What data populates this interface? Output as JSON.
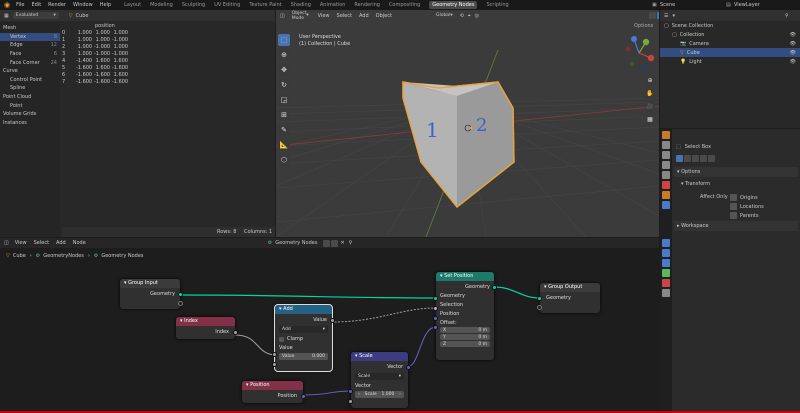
{
  "topbar": {
    "menus": [
      "File",
      "Edit",
      "Render",
      "Window",
      "Help"
    ],
    "workspaces": [
      "Layout",
      "Modeling",
      "Sculpting",
      "UV Editing",
      "Texture Paint",
      "Shading",
      "Animation",
      "Rendering",
      "Compositing",
      "Geometry Nodes",
      "Scripting"
    ],
    "active_workspace": "Geometry Nodes",
    "scene": "Scene",
    "view_layer": "ViewLayer"
  },
  "spreadsheet": {
    "mode": "Evaluated",
    "object": "Cube",
    "tree": [
      {
        "label": "Mesh",
        "indent": 0
      },
      {
        "label": "Vertex",
        "indent": 1,
        "count": "8",
        "selected": true
      },
      {
        "label": "Edge",
        "indent": 1,
        "count": "12"
      },
      {
        "label": "Face",
        "indent": 1,
        "count": "6"
      },
      {
        "label": "Face Corner",
        "indent": 1,
        "count": "24"
      },
      {
        "label": "Curve",
        "indent": 0
      },
      {
        "label": "Control Point",
        "indent": 1
      },
      {
        "label": "Spline",
        "indent": 1
      },
      {
        "label": "Point Cloud",
        "indent": 0
      },
      {
        "label": "Point",
        "indent": 1
      },
      {
        "label": "Volume Grids",
        "indent": 0
      },
      {
        "label": "Instances",
        "indent": 0
      }
    ],
    "column_header": "position",
    "rows": [
      [
        "0",
        "1.000",
        "1.000",
        "1.000"
      ],
      [
        "1",
        "1.000",
        "1.000",
        "-1.000"
      ],
      [
        "2",
        "1.000",
        "-1.000",
        "1.000"
      ],
      [
        "3",
        "1.000",
        "-1.000",
        "-1.000"
      ],
      [
        "4",
        "-1.400",
        "1.600",
        "1.600"
      ],
      [
        "5",
        "-1.600",
        "1.600",
        "-1.600"
      ],
      [
        "6",
        "-1.600",
        "-1.600",
        "1.600"
      ],
      [
        "7",
        "-1.600",
        "-1.600",
        "-1.600"
      ]
    ],
    "footer_rows": "Rows: 8",
    "footer_cols": "Columns: 1"
  },
  "viewport": {
    "mode": "Object Mode",
    "menus": [
      "View",
      "Select",
      "Add",
      "Object"
    ],
    "orientation": "Global",
    "overlay_title": "User Perspective",
    "overlay_subtitle": "(1) Collection | Cube",
    "options": "Options",
    "cube_text_1": "1",
    "cube_text_2": "2",
    "gizmo": {
      "x": "X",
      "y": "Y",
      "z": "Z"
    }
  },
  "outliner": {
    "title": "Scene Collection",
    "items": [
      {
        "label": "Collection",
        "indent": 1
      },
      {
        "label": "Camera",
        "indent": 2
      },
      {
        "label": "Cube",
        "indent": 2,
        "selected": true
      },
      {
        "label": "Light",
        "indent": 2
      }
    ]
  },
  "properties": {
    "tool": "Select Box",
    "options": "Options",
    "transform": "Transform",
    "affect_only": "Affect Only",
    "checks": [
      "Origins",
      "Locations",
      "Parents"
    ],
    "workspace": "Workspace"
  },
  "node_editor": {
    "menus": [
      "View",
      "Select",
      "Add",
      "Node"
    ],
    "tree_name": "Geometry Nodes",
    "breadcrumb": [
      "Cube",
      "GeometryNodes",
      "Geometry Nodes"
    ],
    "nodes": {
      "group_input": {
        "title": "Group Input",
        "out": "Geometry"
      },
      "group_output": {
        "title": "Group Output",
        "in": "Geometry"
      },
      "index": {
        "title": "Index",
        "out": "Index"
      },
      "add": {
        "title": "Add",
        "out": "Value",
        "op": "Add",
        "clamp": "Clamp",
        "in": "Value",
        "field_label": "Value",
        "field_value": "0.000"
      },
      "position": {
        "title": "Position",
        "out": "Position"
      },
      "scale": {
        "title": "Scale",
        "out": "Vector",
        "op": "Scale",
        "in": "Vector",
        "scale_label": "Scale",
        "scale_value": "1.000"
      },
      "set_position": {
        "title": "Set Position",
        "out": "Geometry",
        "in_geometry": "Geometry",
        "selection": "Selection",
        "position": "Position",
        "offset": "Offset:",
        "x": "X",
        "y": "Y",
        "z": "Z",
        "zero": "0 m"
      }
    }
  },
  "colors": {
    "accent": "#e8a33a",
    "selected": "#334d80",
    "geometry_socket": "#00d6a3",
    "vector_socket": "#6363c7",
    "float_socket": "#a1a1a1",
    "index_header": "#83314a",
    "add_header": "#246283",
    "scale_header": "#3c3c83",
    "setpos_header": "#1b7a6a"
  }
}
